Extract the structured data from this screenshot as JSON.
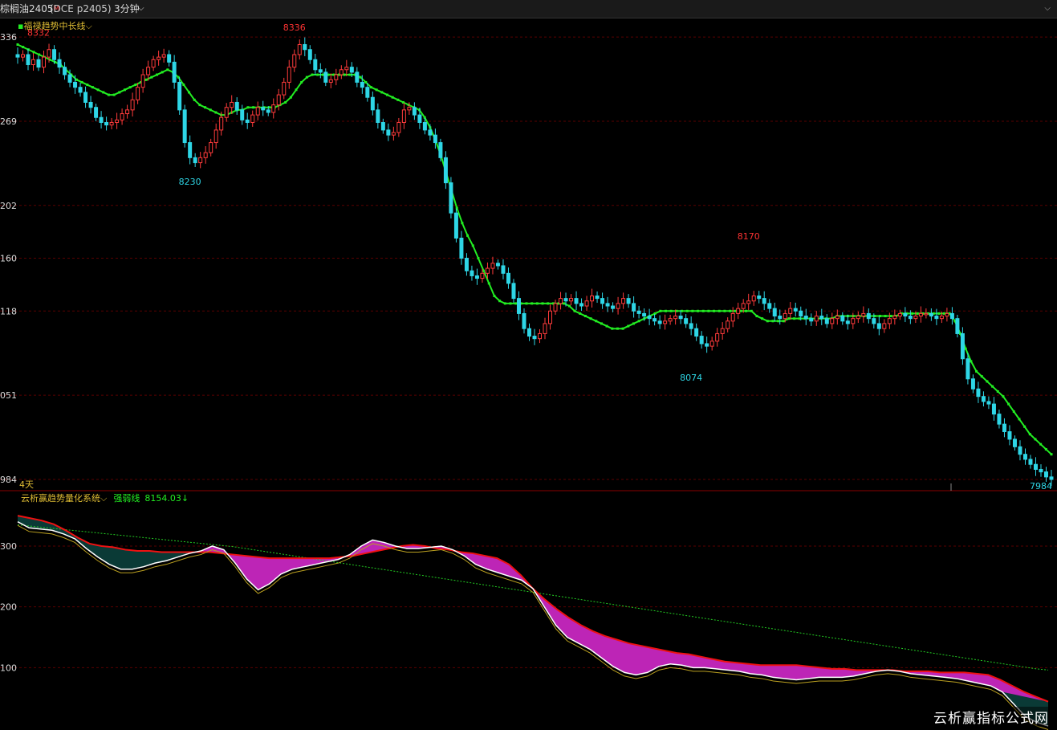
{
  "header": {
    "symbol": "棕榈油2405",
    "marker": "M",
    "exchange": "(DCE p2405)",
    "period": "3分钟",
    "caret": "⌵"
  },
  "main_panel": {
    "indicator_label": "福禄趋势中长线",
    "indicator_caret": "⌵",
    "y_tick_labels": [
      "336",
      "269",
      "202",
      "160",
      "118",
      "051",
      "984"
    ],
    "bottom_left_label": "4天",
    "last_price_label": "7984",
    "annotations": [
      {
        "text": "8332",
        "color": "#ff3333"
      },
      {
        "text": "8336",
        "color": "#ff3333"
      },
      {
        "text": "8230",
        "color": "#2ed6e6"
      },
      {
        "text": "8170",
        "color": "#ff3333"
      },
      {
        "text": "8074",
        "color": "#2ed6e6"
      }
    ]
  },
  "sub_panel": {
    "indicator_label": "云析赢趋势量化系统",
    "indicator_caret": "⌵",
    "strength_label": "强弱线",
    "strength_value": "8154.03↓",
    "y_tick_labels": [
      "300",
      "200",
      "100"
    ]
  },
  "watermark": "云析赢指标公式网",
  "colors": {
    "up": "#ff3b3b",
    "down": "#2ed6e6",
    "trend": "#22ee22",
    "grid": "#5a0000",
    "fill": "#0a3a36",
    "red_line": "#ee1111",
    "magenta": "#dd22cc"
  },
  "chart_data": {
    "type": "candlestick",
    "main": {
      "price_ticks": [
        8336,
        8269,
        8202,
        8160,
        8118,
        8051,
        7984
      ],
      "ylim": [
        7984,
        8345
      ],
      "highs_lows": [
        {
          "label": "8332",
          "kind": "high"
        },
        {
          "label": "8336",
          "kind": "high"
        },
        {
          "label": "8230",
          "kind": "low"
        },
        {
          "label": "8170",
          "kind": "high"
        },
        {
          "label": "8074",
          "kind": "low"
        }
      ],
      "close_path": [
        8320,
        8322,
        8314,
        8318,
        8312,
        8320,
        8326,
        8318,
        8312,
        8306,
        8300,
        8296,
        8292,
        8284,
        8280,
        8272,
        8268,
        8266,
        8268,
        8270,
        8275,
        8278,
        8286,
        8296,
        8306,
        8312,
        8318,
        8320,
        8322,
        8316,
        8300,
        8278,
        8252,
        8240,
        8236,
        8240,
        8244,
        8252,
        8262,
        8272,
        8280,
        8284,
        8278,
        8270,
        8268,
        8274,
        8280,
        8278,
        8276,
        8282,
        8290,
        8300,
        8312,
        8322,
        8330,
        8326,
        8318,
        8310,
        8308,
        8300,
        8302,
        8306,
        8310,
        8312,
        8308,
        8300,
        8296,
        8288,
        8278,
        8268,
        8262,
        8258,
        8260,
        8268,
        8278,
        8280,
        8274,
        8268,
        8262,
        8258,
        8252,
        8240,
        8220,
        8196,
        8176,
        8160,
        8150,
        8146,
        8144,
        8148,
        8152,
        8156,
        8154,
        8148,
        8140,
        8128,
        8116,
        8104,
        8098,
        8096,
        8100,
        8108,
        8118,
        8124,
        8128,
        8126,
        8128,
        8124,
        8122,
        8126,
        8130,
        8128,
        8124,
        8122,
        8120,
        8124,
        8128,
        8124,
        8118,
        8116,
        8114,
        8112,
        8110,
        8108,
        8110,
        8112,
        8114,
        8112,
        8108,
        8104,
        8098,
        8092,
        8090,
        8094,
        8100,
        8104,
        8110,
        8116,
        8120,
        8124,
        8126,
        8130,
        8128,
        8124,
        8120,
        8114,
        8112,
        8116,
        8120,
        8118,
        8114,
        8112,
        8110,
        8114,
        8112,
        8108,
        8112,
        8114,
        8110,
        8108,
        8112,
        8114,
        8116,
        8112,
        8108,
        8104,
        8108,
        8112,
        8114,
        8116,
        8114,
        8112,
        8114,
        8116,
        8116,
        8114,
        8112,
        8114,
        8116,
        8112,
        8100,
        8080,
        8064,
        8056,
        8050,
        8046,
        8044,
        8036,
        8028,
        8022,
        8016,
        8010,
        8004,
        8000,
        7996,
        7992,
        7990,
        7986,
        7984
      ],
      "trend_line": [
        8330,
        8328,
        8326,
        8324,
        8322,
        8320,
        8318,
        8316,
        8314,
        8310,
        8306,
        8302,
        8300,
        8298,
        8296,
        8294,
        8292,
        8290,
        8290,
        8292,
        8294,
        8296,
        8298,
        8300,
        8302,
        8304,
        8306,
        8308,
        8310,
        8308,
        8304,
        8298,
        8292,
        8286,
        8282,
        8280,
        8278,
        8276,
        8274,
        8274,
        8276,
        8278,
        8278,
        8280,
        8280,
        8280,
        8280,
        8280,
        8280,
        8282,
        8284,
        8288,
        8294,
        8300,
        8304,
        8306,
        8306,
        8306,
        8306,
        8306,
        8306,
        8306,
        8306,
        8306,
        8304,
        8300,
        8296,
        8294,
        8292,
        8290,
        8288,
        8286,
        8284,
        8282,
        8280,
        8278,
        8272,
        8264,
        8254,
        8242,
        8228,
        8214,
        8200,
        8188,
        8178,
        8170,
        8160,
        8150,
        8140,
        8130,
        8126,
        8124,
        8124,
        8124,
        8124,
        8124,
        8124,
        8124,
        8124,
        8124,
        8124,
        8124,
        8124,
        8122,
        8118,
        8116,
        8114,
        8112,
        8110,
        8108,
        8106,
        8104,
        8104,
        8104,
        8106,
        8108,
        8110,
        8112,
        8114,
        8116,
        8118,
        8118,
        8118,
        8118,
        8118,
        8118,
        8118,
        8118,
        8118,
        8118,
        8118,
        8118,
        8118,
        8118,
        8118,
        8118,
        8118,
        8118,
        8114,
        8112,
        8110,
        8110,
        8110,
        8110,
        8112,
        8112,
        8112,
        8112,
        8112,
        8112,
        8112,
        8112,
        8112,
        8114,
        8114,
        8114,
        8114,
        8114,
        8114,
        8114,
        8114,
        8114,
        8114,
        8114,
        8114,
        8116,
        8116,
        8116,
        8116,
        8116,
        8116,
        8116,
        8116,
        8116,
        8116,
        8110,
        8100,
        8088,
        8078,
        8070,
        8066,
        8062,
        8058,
        8054,
        8050,
        8044,
        8038,
        8032,
        8026,
        8020,
        8016,
        8012,
        8008,
        8004
      ]
    },
    "sub": {
      "ticks": [
        300,
        200,
        100
      ],
      "ylim": [
        0,
        370
      ],
      "white_line": [
        340,
        330,
        328,
        326,
        320,
        312,
        296,
        282,
        270,
        262,
        262,
        266,
        272,
        276,
        282,
        288,
        292,
        300,
        294,
        272,
        246,
        228,
        238,
        254,
        262,
        266,
        270,
        274,
        278,
        286,
        300,
        310,
        306,
        300,
        296,
        296,
        298,
        300,
        294,
        284,
        270,
        262,
        256,
        250,
        244,
        230,
        200,
        170,
        150,
        140,
        130,
        116,
        102,
        92,
        88,
        92,
        102,
        106,
        104,
        100,
        100,
        98,
        96,
        94,
        90,
        88,
        84,
        82,
        80,
        82,
        84,
        84,
        84,
        86,
        90,
        94,
        96,
        94,
        90,
        88,
        86,
        84,
        82,
        78,
        74,
        70,
        60,
        40,
        20,
        10,
        4
      ],
      "red_line": [
        350,
        346,
        342,
        336,
        326,
        314,
        304,
        300,
        298,
        294,
        292,
        292,
        290,
        290,
        290,
        290,
        290,
        288,
        286,
        284,
        282,
        280,
        280,
        280,
        280,
        280,
        280,
        282,
        284,
        288,
        292,
        296,
        300,
        302,
        300,
        296,
        294,
        290,
        288,
        284,
        280,
        270,
        252,
        230,
        212,
        196,
        182,
        170,
        160,
        152,
        146,
        140,
        136,
        132,
        128,
        124,
        122,
        118,
        114,
        110,
        108,
        106,
        104,
        104,
        104,
        104,
        102,
        100,
        98,
        98,
        96,
        96,
        96,
        96,
        94,
        94,
        94,
        92,
        92,
        92,
        90,
        88,
        80,
        70,
        60,
        52,
        44
      ],
      "strength_line": [
        335,
        333,
        331,
        329,
        327,
        325,
        323,
        321,
        319,
        317,
        315,
        313,
        311,
        309,
        307,
        305,
        303,
        301,
        299,
        296,
        293,
        290,
        287,
        284,
        281,
        278,
        275,
        272,
        269,
        266,
        263,
        260,
        257,
        254,
        251,
        248,
        245,
        242,
        239,
        236,
        233,
        230,
        227,
        224,
        221,
        218,
        215,
        212,
        209,
        206,
        203,
        200,
        197,
        194,
        191,
        188,
        185,
        182,
        179,
        176,
        173,
        170,
        167,
        164,
        161,
        158,
        155,
        152,
        149,
        146,
        143,
        140,
        137,
        134,
        131,
        128,
        125,
        122,
        119,
        116,
        113,
        110,
        107,
        104,
        101,
        98,
        96
      ]
    }
  }
}
